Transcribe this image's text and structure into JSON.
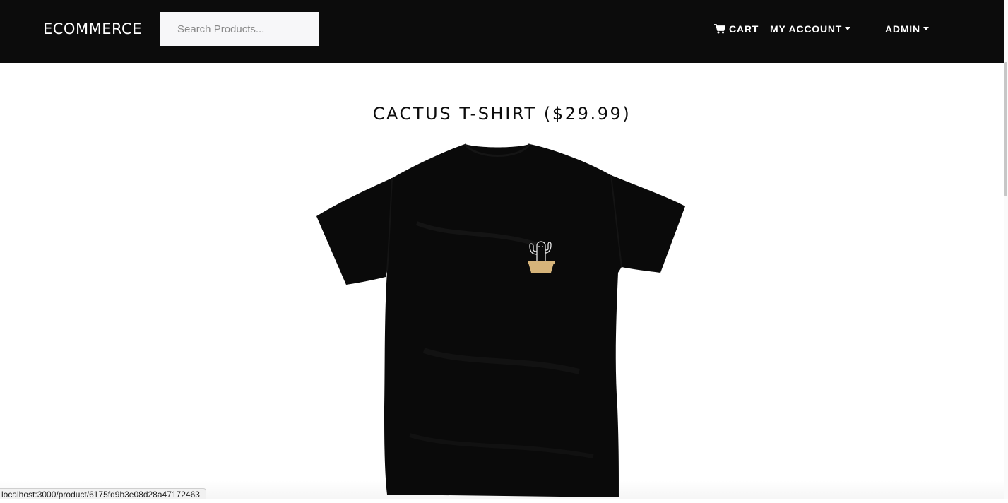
{
  "navbar": {
    "brand": "ECOMMERCE",
    "search_placeholder": "Search Products...",
    "cart_label": "CART",
    "cart_icon": "shopping-cart-icon",
    "account_label": "MY ACCOUNT",
    "admin_label": "ADMIN"
  },
  "product": {
    "title": "CACTUS T-SHIRT ($29.99)",
    "image_description": "black t-shirt with small cactus print"
  },
  "status_bar": {
    "url": "localhost:3000/product/6175fd9b3e08d28a47172463"
  },
  "colors": {
    "navbar_bg": "#0c0c0c",
    "shirt": "#0a0a0a",
    "pot": "#d6b47a"
  }
}
